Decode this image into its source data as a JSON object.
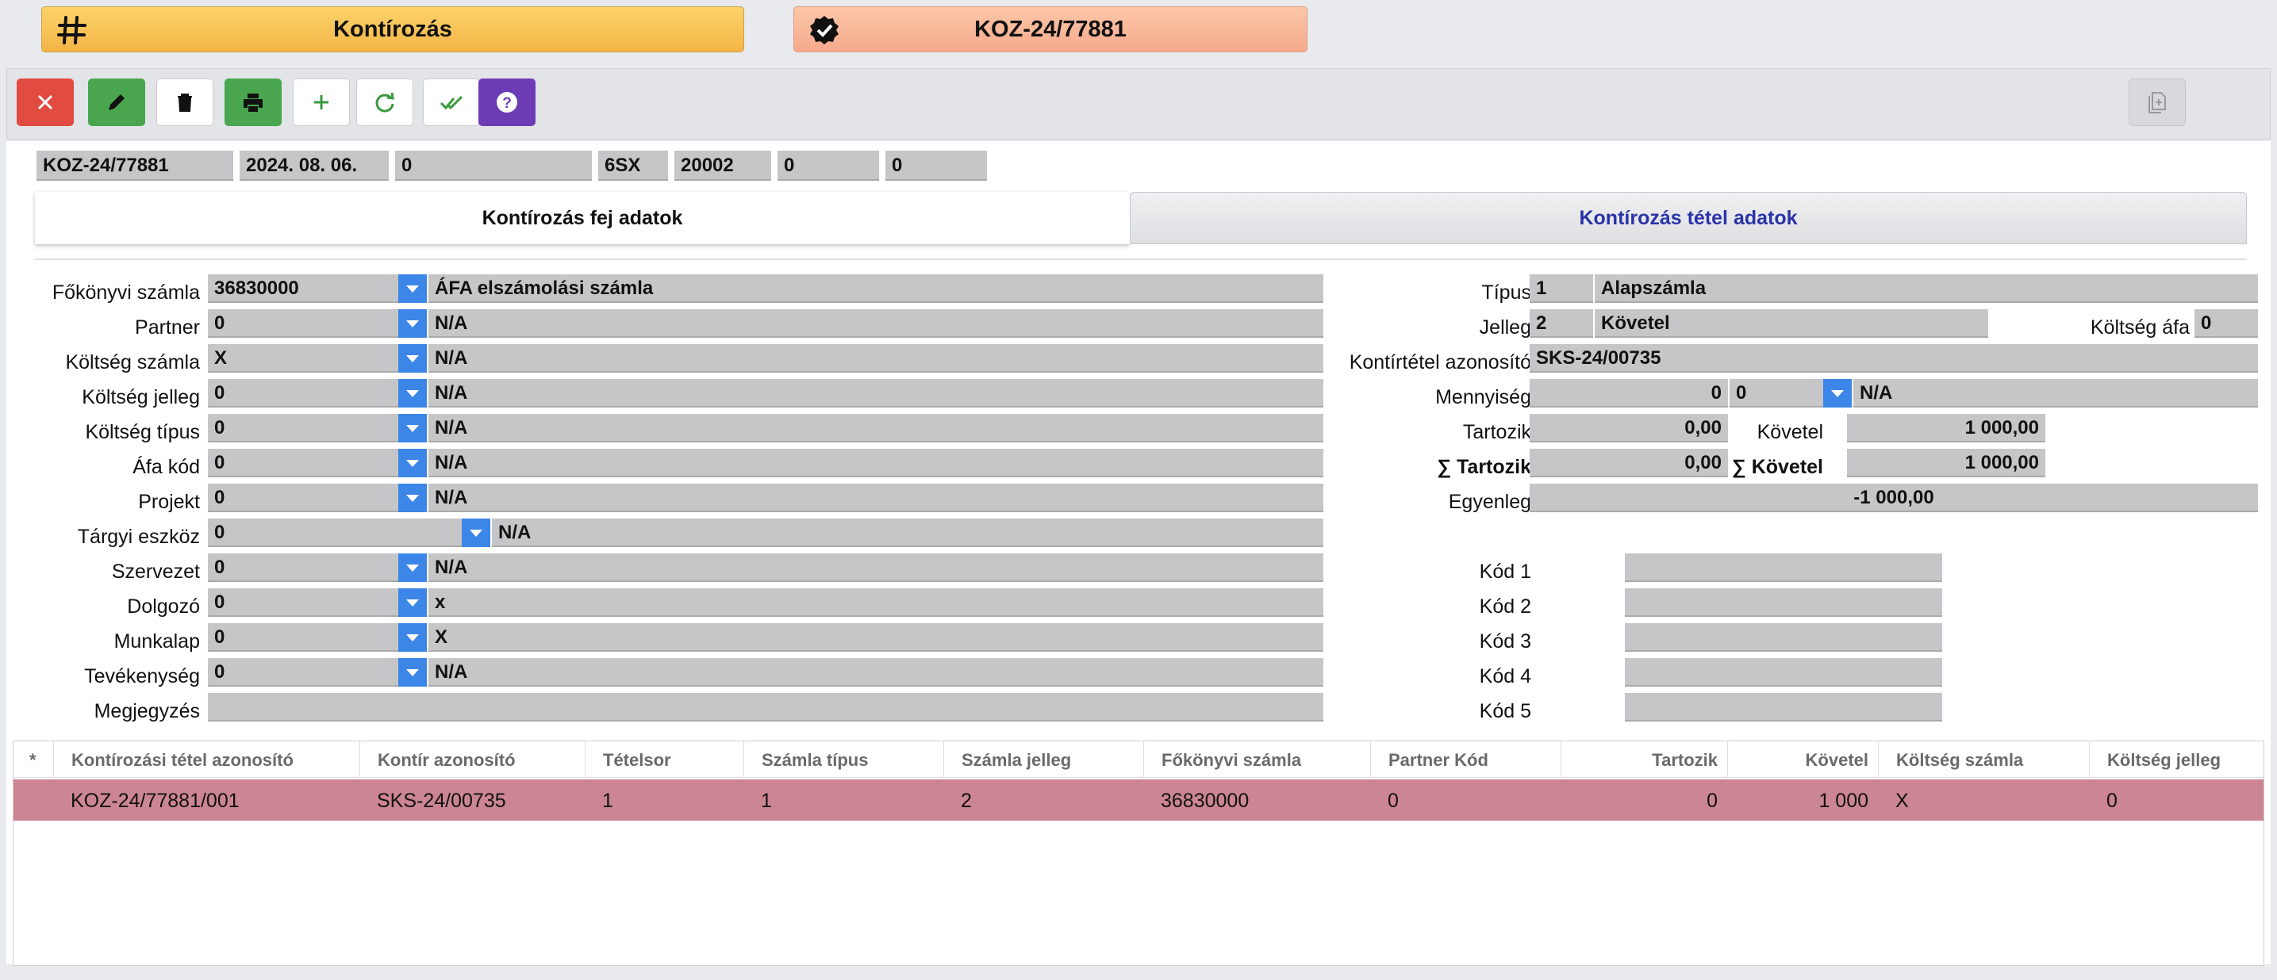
{
  "title_bar": {
    "module_title": "Kontírozás",
    "record_title": "KOZ-24/77881"
  },
  "toolbar": {
    "close_icon": "x",
    "edit_icon": "pencil",
    "delete_icon": "trash",
    "print_icon": "printer",
    "add_icon": "+",
    "refresh_icon": "refresh",
    "approve_icon": "double-check",
    "help_icon": "?",
    "copy_icon": "document-copy"
  },
  "header_fields": [
    "KOZ-24/77881",
    "2024. 08. 06.",
    "0",
    "6SX",
    "20002",
    "0",
    "0"
  ],
  "tabs": {
    "head": "Kontírozás fej adatok",
    "items": "Kontírozás tétel adatok"
  },
  "left_form": {
    "fokonyvi_szamla": {
      "label": "Főkönyvi számla",
      "code": "36830000",
      "name": "ÁFA elszámolási számla"
    },
    "partner": {
      "label": "Partner",
      "code": "0",
      "name": "N/A"
    },
    "koltseg_szamla": {
      "label": "Költség számla",
      "code": "X",
      "name": "N/A"
    },
    "koltseg_jelleg": {
      "label": "Költség jelleg",
      "code": "0",
      "name": "N/A"
    },
    "koltseg_tipus": {
      "label": "Költség típus",
      "code": "0",
      "name": "N/A"
    },
    "afa_kod": {
      "label": "Áfa kód",
      "code": "0",
      "name": "N/A"
    },
    "projekt": {
      "label": "Projekt",
      "code": "0",
      "name": "N/A"
    },
    "targyi_eszkoz": {
      "label": "Tárgyi eszköz",
      "code": "0",
      "name": "N/A"
    },
    "szervezet": {
      "label": "Szervezet",
      "code": "0",
      "name": "N/A"
    },
    "dolgozo": {
      "label": "Dolgozó",
      "code": "0",
      "name": "x"
    },
    "munkalap": {
      "label": "Munkalap",
      "code": "0",
      "name": "X"
    },
    "tevekenyseg": {
      "label": "Tevékenység",
      "code": "0",
      "name": "N/A"
    },
    "megjegyzes": {
      "label": "Megjegyzés",
      "value": ""
    }
  },
  "right_form": {
    "tipus": {
      "label": "Típus",
      "code": "1",
      "name": "Alapszámla"
    },
    "jelleg": {
      "label": "Jelleg",
      "code": "2",
      "name": "Követel"
    },
    "koltseg_afa": {
      "label": "Költség áfa",
      "value": "0"
    },
    "kontirtetel_azonosito": {
      "label": "Kontírtétel azonosító",
      "value": "SKS-24/00735"
    },
    "mennyiseg": {
      "label": "Mennyiség",
      "value": "0",
      "unit_code": "0",
      "unit_name": "N/A"
    },
    "tartozik": {
      "label": "Tartozik",
      "value": "0,00"
    },
    "kovetel": {
      "label": "Követel",
      "value": "1 000,00"
    },
    "sum_tartozik": {
      "label": "∑ Tartozik",
      "value": "0,00"
    },
    "sum_kovetel": {
      "label": "∑ Követel",
      "value": "1 000,00"
    },
    "egyenleg": {
      "label": "Egyenleg",
      "value": "-1 000,00"
    },
    "kodok": [
      {
        "label": "Kód 1",
        "value": ""
      },
      {
        "label": "Kód 2",
        "value": ""
      },
      {
        "label": "Kód 3",
        "value": ""
      },
      {
        "label": "Kód 4",
        "value": ""
      },
      {
        "label": "Kód 5",
        "value": ""
      }
    ]
  },
  "grid": {
    "marker": "*",
    "columns": [
      "Kontírozási tétel azonosító",
      "Kontír azonosító",
      "Tételsor",
      "Számla típus",
      "Számla jelleg",
      "Főkönyvi számla",
      "Partner Kód",
      "Tartozik",
      "Követel",
      "Költség számla",
      "Költség jelleg"
    ],
    "rows": [
      [
        "KOZ-24/77881/001",
        "SKS-24/00735",
        "1",
        "1",
        "2",
        "36830000",
        "0",
        "0",
        "1 000",
        "X",
        "0"
      ]
    ]
  },
  "colors": {
    "title_orange": "#f4b547",
    "title_salmon": "#f6a98c",
    "dropdown_blue": "#3c86e8",
    "selected_row": "#cc8592",
    "tab_link": "#2a33a8"
  }
}
